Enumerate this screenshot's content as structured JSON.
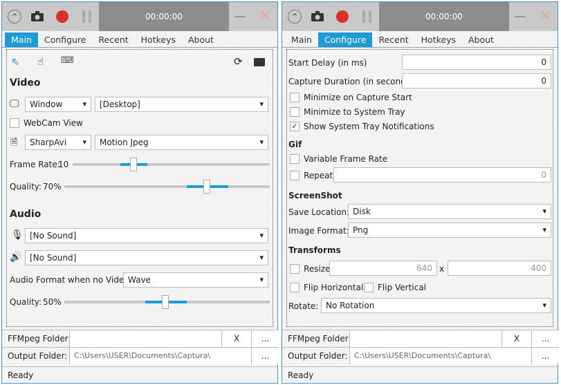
{
  "titlebar": {
    "timer": "00:00:00"
  },
  "tabs": [
    "Main",
    "Configure",
    "Recent",
    "Hotkeys",
    "About"
  ],
  "main": {
    "video_heading": "Video",
    "source_type": "Window",
    "source": "[Desktop]",
    "webcam_label": "WebCam View",
    "encoder": "SharpAvi",
    "codec": "Motion Jpeg",
    "frame_rate_label": "Frame Rate:",
    "frame_rate": "10",
    "frame_rate_value": 10,
    "frame_rate_range": [
      1,
      30
    ],
    "quality_label": "Quality:",
    "quality": "70%",
    "quality_value": 70,
    "audio_heading": "Audio",
    "mic": "[No Sound]",
    "speaker": "[No Sound]",
    "audio_format_label": "Audio Format when no Video:",
    "audio_format": "Wave",
    "audio_quality_label": "Quality:",
    "audio_quality": "50%",
    "audio_quality_value": 50
  },
  "configure": {
    "start_delay_label": "Start Delay (in ms)",
    "start_delay": "0",
    "capture_duration_label": "Capture Duration (in seconds)",
    "capture_duration": "0",
    "minimize_on_start": "Minimize on Capture Start",
    "minimize_to_tray": "Minimize to System Tray",
    "show_tray_notifications": "Show System Tray Notifications",
    "gif_heading": "Gif",
    "variable_frame_rate": "Variable Frame Rate",
    "repeat": "Repeat",
    "repeat_value": "0",
    "screenshot_heading": "ScreenShot",
    "save_location_label": "Save Location:",
    "save_location": "Disk",
    "image_format_label": "Image Format:",
    "image_format": "Png",
    "transforms_heading": "Transforms",
    "resize": "Resize",
    "resize_width": "640",
    "x": "x",
    "resize_height": "400",
    "flip_horizontal": "Flip Horizontal",
    "flip_vertical": "Flip Vertical",
    "rotate_label": "Rotate:",
    "rotate": "No Rotation"
  },
  "footer": {
    "ffmpeg_label": "FFMpeg Folder:",
    "ffmpeg_value": "",
    "clear": "X",
    "browse": "...",
    "output_label": "Output Folder:",
    "output_value": "C:\\Users\\USER\\Documents\\Captura\\",
    "status": "Ready"
  },
  "colors": {
    "accent": "#1e9ad6",
    "record": "#d9302c"
  }
}
